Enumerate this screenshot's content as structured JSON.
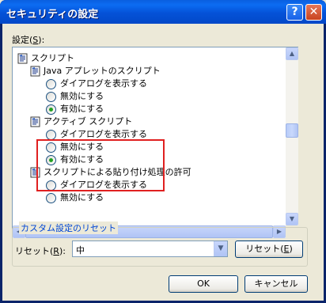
{
  "window": {
    "title": "セキュリティの設定",
    "help_glyph": "?",
    "close_glyph": "✕"
  },
  "settings_label": {
    "text": "設定(",
    "accel": "S",
    "suffix": "):"
  },
  "tree": {
    "items": [
      {
        "kind": "category",
        "label": "スクリプト"
      },
      {
        "kind": "setting",
        "label": "Java アプレットのスクリプト"
      },
      {
        "kind": "option",
        "label": "ダイアログを表示する",
        "checked": false
      },
      {
        "kind": "option",
        "label": "無効にする",
        "checked": false
      },
      {
        "kind": "option",
        "label": "有効にする",
        "checked": true
      },
      {
        "kind": "setting",
        "label": "アクティブ スクリプト"
      },
      {
        "kind": "option",
        "label": "ダイアログを表示する",
        "checked": false
      },
      {
        "kind": "option",
        "label": "無効にする",
        "checked": false
      },
      {
        "kind": "option",
        "label": "有効にする",
        "checked": true
      },
      {
        "kind": "setting",
        "label": "スクリプトによる貼り付け処理の許可"
      },
      {
        "kind": "option",
        "label": "ダイアログを表示する",
        "checked": false
      },
      {
        "kind": "option",
        "label": "無効にする",
        "checked": false
      }
    ]
  },
  "reset_group": {
    "title": "カスタム設定のリセット",
    "reset_label": {
      "text": "リセット(",
      "accel": "R",
      "suffix": "):"
    },
    "combo_value": "中",
    "reset_button": {
      "text": "リセット(",
      "accel": "E",
      "suffix": ")"
    }
  },
  "buttons": {
    "ok": "OK",
    "cancel": "キャンセル"
  },
  "colors": {
    "highlight_box": "#E02020",
    "title_bar": "#0452D8",
    "group_title": "#0046D5"
  }
}
